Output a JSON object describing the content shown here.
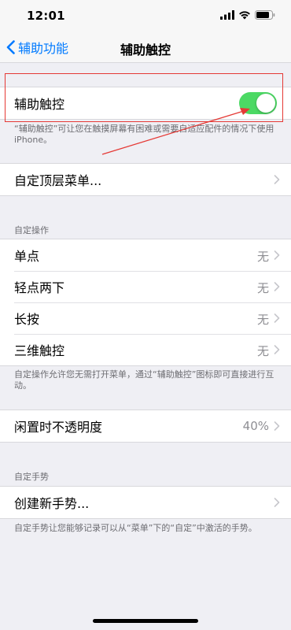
{
  "status_bar": {
    "time": "12:01"
  },
  "nav": {
    "back_label": "辅助功能",
    "title": "辅助触控"
  },
  "main_toggle": {
    "label": "辅助触控",
    "enabled": true,
    "description": "“辅助触控”可让您在触摸屏幕有困难或需要自适应配件的情况下使用 iPhone。"
  },
  "top_menu": {
    "label": "自定顶层菜单..."
  },
  "custom_actions": {
    "header": "自定操作",
    "rows": [
      {
        "label": "单点",
        "value": "无"
      },
      {
        "label": "轻点两下",
        "value": "无"
      },
      {
        "label": "长按",
        "value": "无"
      },
      {
        "label": "三维触控",
        "value": "无"
      }
    ],
    "footer": "自定操作允许您无需打开菜单，通过“辅助触控”图标即可直接进行互动。"
  },
  "idle_opacity": {
    "label": "闲置时不透明度",
    "value": "40%"
  },
  "custom_gestures": {
    "header": "自定手势",
    "create_label": "创建新手势...",
    "footer": "自定手势让您能够记录可以从“菜单”下的“自定”中激活的手势。"
  },
  "colors": {
    "accent": "#007aff",
    "toggle_on": "#4cd964",
    "annotation": "#e53935"
  },
  "icons": [
    "signal-icon",
    "wifi-icon",
    "battery-icon",
    "chevron-left-icon",
    "chevron-right-icon"
  ]
}
